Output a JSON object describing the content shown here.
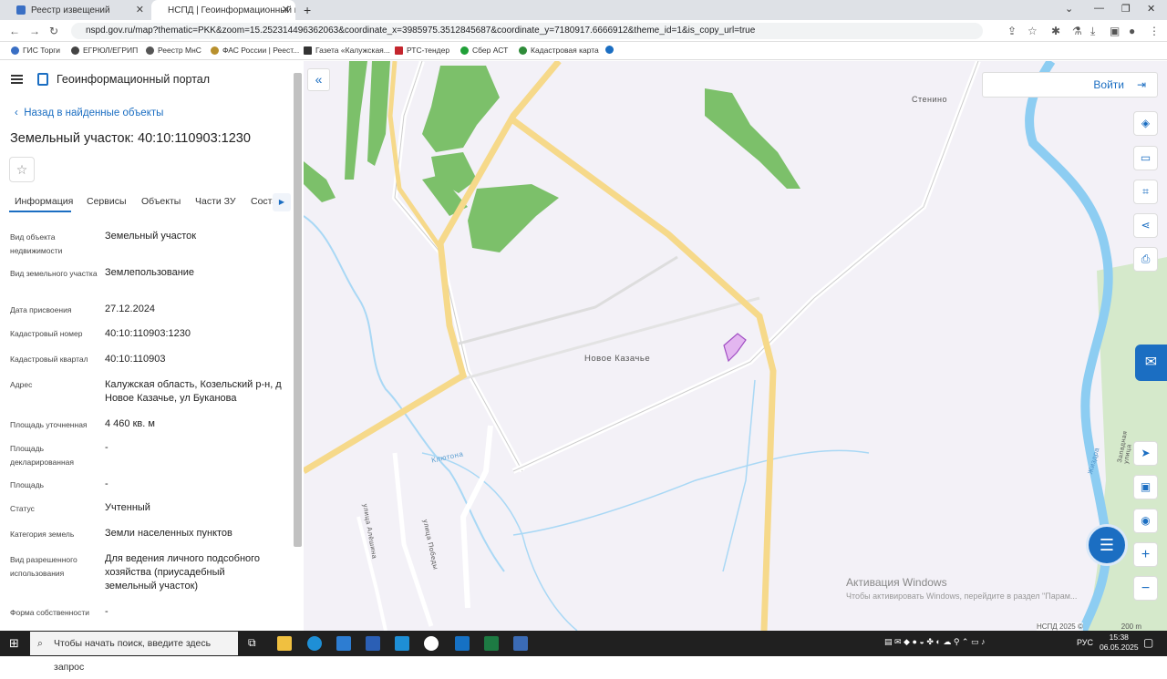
{
  "browser": {
    "tabs": [
      {
        "title": "Реестр извещений",
        "active": false
      },
      {
        "title": "НСПД | Геоинформационный п...",
        "active": true
      }
    ],
    "url": "nspd.gov.ru/map?thematic=PKK&zoom=15.252314496362063&coordinate_x=3985975.3512845687&coordinate_y=7180917.6666912&theme_id=1&is_copy_url=true",
    "bookmarks": [
      "ГИС Торги",
      "ЕГРЮЛ/ЕГРИП",
      "Реестр МнС",
      "ФАС России | Реест...",
      "Газета «Калужская...",
      "РТС-тендер",
      "Сбер АСТ",
      "Кадастровая карта"
    ]
  },
  "panel": {
    "portal_title": "Геоинформационный портал",
    "back_label": "Назад в найденные объекты",
    "object_title": "Земельный участок: 40:10:110903:1230",
    "tabs": [
      "Информация",
      "Сервисы",
      "Объекты",
      "Части ЗУ",
      "Соста..."
    ],
    "fields": [
      {
        "label": "Вид объекта недвижимости",
        "value": "Земельный участок"
      },
      {
        "label": "Вид земельного участка",
        "value": "Землепользование"
      },
      {
        "label": "Дата присвоения",
        "value": "27.12.2024"
      },
      {
        "label": "Кадастровый номер",
        "value": "40:10:110903:1230"
      },
      {
        "label": "Кадастровый квартал",
        "value": "40:10:110903"
      },
      {
        "label": "Адрес",
        "value": "Калужская область, Козельский р-н, д Новое Казачье, ул Буканова"
      },
      {
        "label": "Площадь уточненная",
        "value": "4 460 кв. м"
      },
      {
        "label": "Площадь декларированная",
        "value": "-"
      },
      {
        "label": "Площадь",
        "value": "-"
      },
      {
        "label": "Статус",
        "value": "Учтенный"
      },
      {
        "label": "Категория земель",
        "value": "Земли населенных пунктов"
      },
      {
        "label": "Вид разрешенного использования",
        "value": "Для ведения личного подсобного хозяйства (приусадебный земельный участок)"
      },
      {
        "label": "Форма собственности",
        "value": "-"
      }
    ]
  },
  "map": {
    "login_label": "Войти",
    "labels": {
      "village": "Новое Казачье",
      "stenino": "Стенино",
      "stream": "Клютона",
      "street1": "улица Алёшина",
      "street2": "улица Победы",
      "river": "Жиздра",
      "street3": "Западная улица"
    },
    "watermark_title": "Активация Windows",
    "watermark_sub": "Чтобы активировать Windows, перейдите в раздел \"Парам...",
    "copyright": "НСПД 2025 ©",
    "scale": "200 m"
  },
  "taskbar": {
    "search_placeholder": "Чтобы начать поиск, введите здесь запрос",
    "lang": "РУС",
    "time": "15:38",
    "date": "06.05.2025"
  }
}
